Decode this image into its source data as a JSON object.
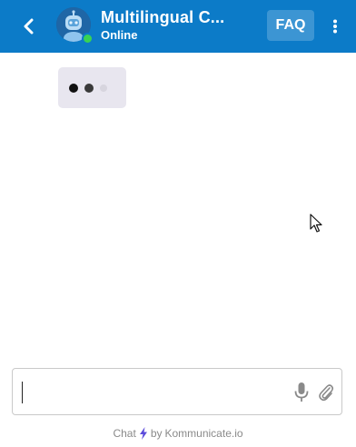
{
  "header": {
    "title": "Multilingual C...",
    "status": "Online",
    "faq_label": "FAQ",
    "online_color": "#39d353",
    "brand_color": "#0c7bc8"
  },
  "chat": {
    "typing_indicator": true
  },
  "composer": {
    "message_value": "",
    "placeholder": ""
  },
  "footer": {
    "prefix": "Chat",
    "middle": "by",
    "brand": "Kommunicate.io"
  },
  "icons": {
    "back": "chevron-left-icon",
    "avatar": "robot-icon",
    "more": "vertical-dots-icon",
    "mic": "microphone-icon",
    "attach": "paperclip-icon",
    "bolt": "lightning-bolt-icon",
    "cursor": "mouse-pointer-icon"
  }
}
